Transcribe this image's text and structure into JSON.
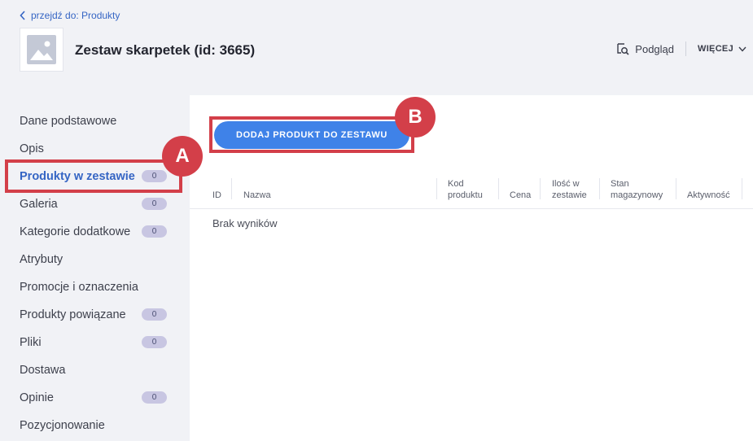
{
  "header": {
    "back_label": "przejdź do: Produkty",
    "title": "Zestaw skarpetek (id: 3665)",
    "preview_label": "Podgląd",
    "more_label": "WIĘCEJ"
  },
  "sidebar": {
    "items": [
      {
        "label": "Dane podstawowe"
      },
      {
        "label": "Opis"
      },
      {
        "label": "Produkty w zestawie",
        "badge": "0",
        "active": true
      },
      {
        "label": "Galeria",
        "badge": "0"
      },
      {
        "label": "Kategorie dodatkowe",
        "badge": "0"
      },
      {
        "label": "Atrybuty"
      },
      {
        "label": "Promocje i oznaczenia"
      },
      {
        "label": "Produkty powiązane",
        "badge": "0"
      },
      {
        "label": "Pliki",
        "badge": "0"
      },
      {
        "label": "Dostawa"
      },
      {
        "label": "Opinie",
        "badge": "0"
      },
      {
        "label": "Pozycjonowanie"
      }
    ]
  },
  "main": {
    "add_button_label": "DODAJ PRODUKT DO ZESTAWU",
    "table": {
      "columns": [
        "ID",
        "Nazwa",
        "Kod produktu",
        "Cena",
        "Ilość w zestawie",
        "Stan magazynowy",
        "Aktywność"
      ]
    },
    "empty_text": "Brak wyników"
  },
  "callouts": {
    "a_label": "A",
    "b_label": "B",
    "color": "#d33f49"
  },
  "colors": {
    "accent": "#3f82e8",
    "link": "#3565c4",
    "badge": "#c8c6e2"
  }
}
